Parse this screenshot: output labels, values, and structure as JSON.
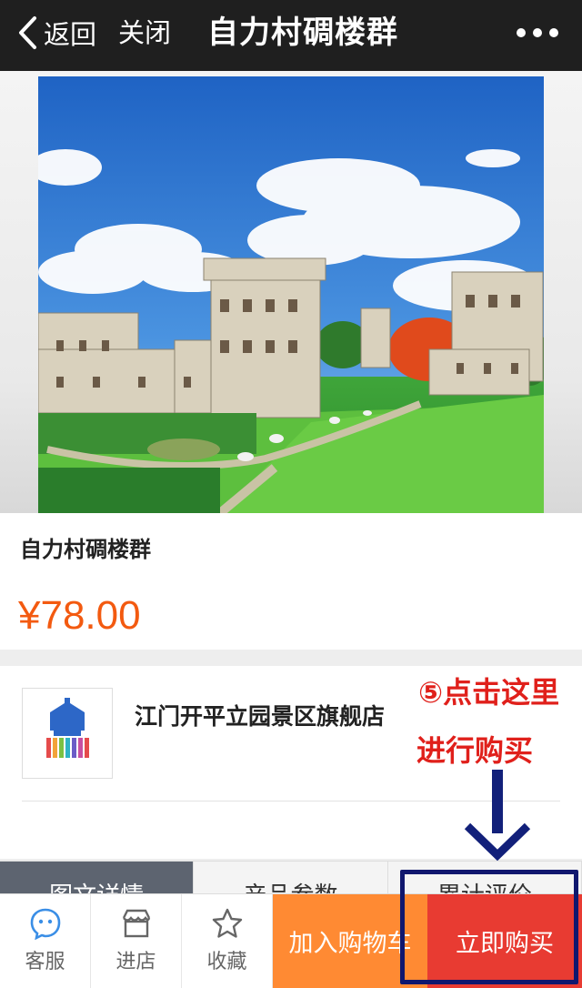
{
  "navbar": {
    "back_label": "返回",
    "close_label": "关闭",
    "title": "自力村碉楼群"
  },
  "product": {
    "title": "自力村碉楼群",
    "price": "¥78.00"
  },
  "store": {
    "name": "江门开平立园景区旗舰店"
  },
  "annotation": {
    "line1": "⑤点击这里",
    "line2": "进行购买"
  },
  "tabs": [
    {
      "label": "图文详情"
    },
    {
      "label": "产品参数"
    },
    {
      "label": "累计评价"
    }
  ],
  "bottom_bar": {
    "service_label": "客服",
    "store_label": "进店",
    "favorite_label": "收藏",
    "add_cart_label": "加入购物车",
    "buy_now_label": "立即购买"
  },
  "colors": {
    "price": "#f35a10",
    "add_cart": "#ff8a33",
    "buy_now": "#e83b32",
    "annotation": "#e0201b",
    "highlight": "#10176e"
  }
}
